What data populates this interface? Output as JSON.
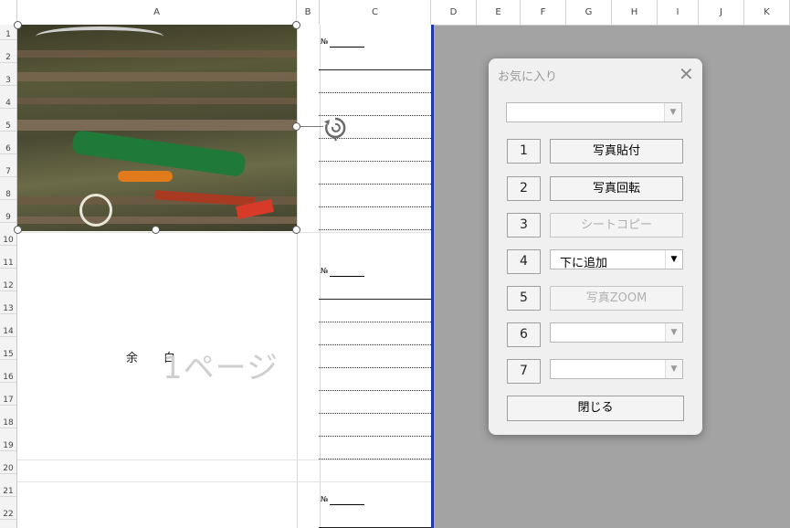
{
  "columns": [
    "A",
    "B",
    "C",
    "D",
    "E",
    "F",
    "G",
    "H",
    "I",
    "J",
    "K"
  ],
  "rows": [
    "1",
    "2",
    "3",
    "4",
    "5",
    "6",
    "7",
    "8",
    "9",
    "10",
    "11",
    "12",
    "13",
    "14",
    "15",
    "16",
    "17",
    "18",
    "19",
    "20",
    "21",
    "22"
  ],
  "sheet": {
    "number_label": "№",
    "watermark": "1ページ",
    "margin_text": "余白"
  },
  "dialog": {
    "title": "お気に入り",
    "close_glyph": "✕",
    "top_combo_value": "",
    "numbers": [
      "1",
      "2",
      "3",
      "4",
      "5",
      "6",
      "7"
    ],
    "buttons": {
      "paste_photo": "写真貼付",
      "rotate_photo": "写真回転",
      "sheet_copy": "シートコピー",
      "add_below": "下に追加",
      "photo_zoom": "写真ZOOM",
      "row6": "",
      "row7": ""
    },
    "close_button": "閉じる"
  },
  "colors": {
    "highlight": "#e00000",
    "page_break": "#1f3aa8"
  }
}
